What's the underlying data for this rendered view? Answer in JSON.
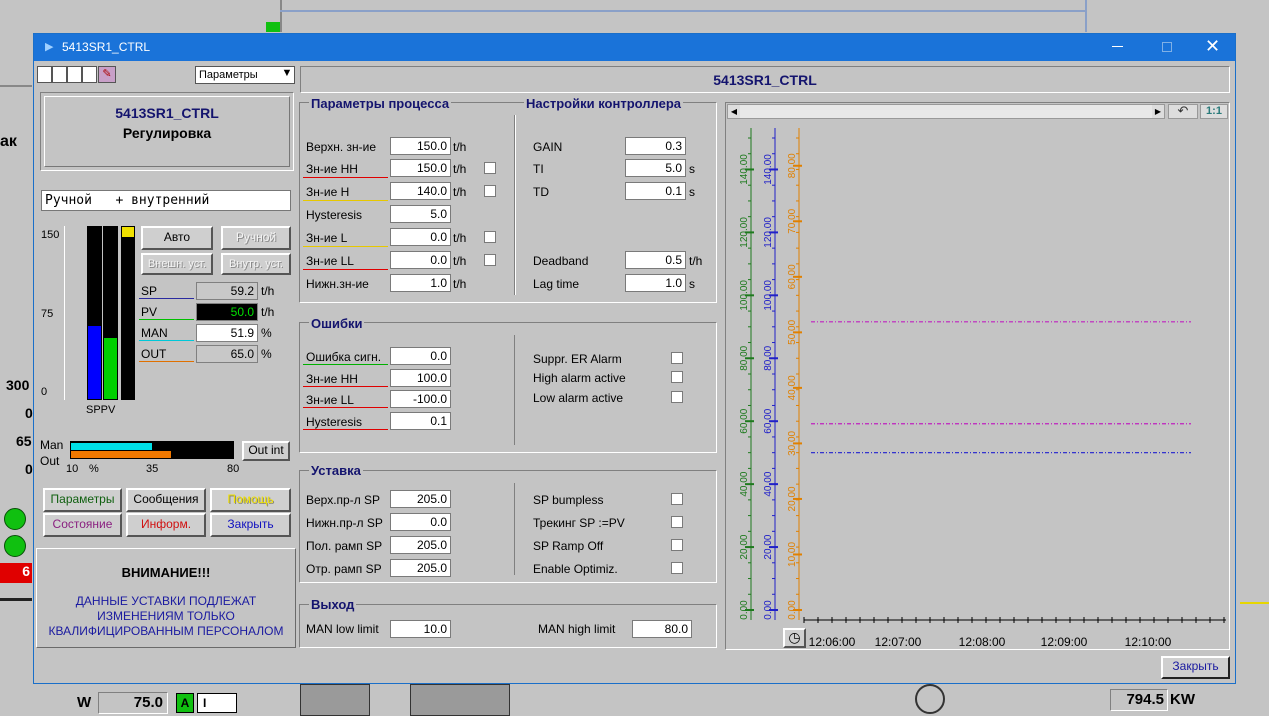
{
  "window": {
    "title": "5413SR1_CTRL"
  },
  "bg": {
    "v300": "300",
    "v0a": "0",
    "v65": "65",
    "v0b": "0",
    "v6": "6",
    "tak": "ак",
    "w_label": "W",
    "w_value": "75.0",
    "a_label": "A",
    "i_label": "I",
    "kw_value": "794.5",
    "kw_unit": "KW"
  },
  "left": {
    "dropdown_value": "Параметры",
    "faceplate_title": "5413SR1_CTRL",
    "faceplate_subtitle": "Регулировка",
    "mode_text": "Ручной   + внутренний",
    "scale": {
      "top": "150",
      "mid": "75",
      "bottom": "0"
    },
    "bars_label": "SPPV",
    "bars": {
      "sp": 0.423,
      "pv": 0.357,
      "out": 0.65,
      "indicator": "#f0e000"
    },
    "buttons": {
      "auto": "Авто",
      "manual": "Ручной",
      "ext_sp": "Внешн. уст.",
      "int_sp": "Внутр. уст."
    },
    "values": [
      {
        "label": "SP",
        "value": "59.2",
        "unit": "t/h",
        "color": "#2a2aa0"
      },
      {
        "label": "PV",
        "value": "50.0",
        "unit": "t/h",
        "color": "#00c000"
      },
      {
        "label": "MAN",
        "value": "51.9",
        "unit": "%",
        "color": "#00c8d8"
      },
      {
        "label": "OUT",
        "value": "65.0",
        "unit": "%",
        "color": "#e07000"
      }
    ],
    "man_label": "Man",
    "out_label": "Out",
    "man_level": 0.5,
    "out_level": 0.62,
    "out_int": "Out int",
    "scale_h": {
      "a": "10",
      "pct": "%",
      "b": "35",
      "c": "80"
    },
    "nav": {
      "params": "Параметры",
      "messages": "Сообщения",
      "help": "Помощь",
      "state": "Состояние",
      "info": "Информ.",
      "close": "Закрыть"
    },
    "warning_title": "ВНИМАНИЕ!!!",
    "warning_text": [
      "ДАННЫЕ УСТАВКИ ПОДЛЕЖАТ",
      "ИЗМЕНЕНИЯМ ТОЛЬКО",
      "КВАЛИФИЦИРОВАННЫМ ПЕРСОНАЛОМ"
    ]
  },
  "main": {
    "title": "5413SR1_CTRL",
    "process": {
      "header": "Параметры процесса",
      "rows": [
        {
          "label": "Верхн. зн-ие",
          "value": "150.0",
          "unit": "t/h"
        },
        {
          "label": "Зн-ие НН",
          "value": "150.0",
          "unit": "t/h"
        },
        {
          "label": "Зн-ие  Н",
          "value": "140.0",
          "unit": "t/h"
        },
        {
          "label": "Hysteresis",
          "value": "5.0",
          "unit": ""
        },
        {
          "label": "Зн-ие L",
          "value": "0.0",
          "unit": "t/h"
        },
        {
          "label": "Зн-ие LL",
          "value": "0.0",
          "unit": "t/h"
        },
        {
          "label": "Нижн.зн-ие",
          "value": "1.0",
          "unit": "t/h"
        }
      ]
    },
    "controller": {
      "header": "Настройки контроллера",
      "rows": [
        {
          "label": "GAIN",
          "value": "0.3",
          "unit": ""
        },
        {
          "label": "TI",
          "value": "5.0",
          "unit": "s"
        },
        {
          "label": "TD",
          "value": "0.1",
          "unit": "s"
        },
        {
          "label": "Deadband",
          "value": "0.5",
          "unit": "t/h"
        },
        {
          "label": "Lag time",
          "value": "1.0",
          "unit": "s"
        }
      ]
    },
    "errors": {
      "header": "Ошибки",
      "rows": [
        {
          "label": "Ошибка сигн.",
          "value": "0.0"
        },
        {
          "label": "Зн-ие НН",
          "value": "100.0"
        },
        {
          "label": "Зн-ие LL",
          "value": "-100.0"
        },
        {
          "label": "Hysteresis",
          "value": "0.1"
        }
      ],
      "flags": [
        "Suppr. ER Alarm",
        "High alarm active",
        "Low alarm active"
      ]
    },
    "setpoint": {
      "header": "Уставка",
      "rows": [
        {
          "label": "Верх.пр-л SP",
          "value": "205.0"
        },
        {
          "label": "Нижн.пр-л SP",
          "value": "0.0"
        },
        {
          "label": "Пол. рамп SP",
          "value": "205.0"
        },
        {
          "label": "Отр. рамп SP",
          "value": "205.0"
        }
      ],
      "flags": [
        "SP bumpless",
        "Трекинг SP :=PV",
        "SP Ramp Off",
        "Enable Optimiz."
      ]
    },
    "output": {
      "header": "Выход",
      "man_low_label": "MAN low limit",
      "man_low_value": "10.0",
      "man_high_label": "MAN high limit",
      "man_high_value": "80.0"
    },
    "close_button": "Закрыть"
  },
  "trend": {
    "zoom_label": "1:1",
    "axes": [
      {
        "color": "#1e7a1e",
        "ticks": [
          "0.00",
          "20.00",
          "40.00",
          "60.00",
          "80.00",
          "100.00",
          "120.00",
          "140.00"
        ],
        "min": 0,
        "max": 150
      },
      {
        "color": "#2020c8",
        "ticks": [
          "0.00",
          "20.00",
          "40.00",
          "60.00",
          "80.00",
          "100.00",
          "120.00",
          "140.00"
        ],
        "min": 0,
        "max": 150
      },
      {
        "color": "#e08000",
        "ticks": [
          "0.00",
          "10.00",
          "20.00",
          "30.00",
          "40.00",
          "50.00",
          "60.00",
          "70.00",
          "80.00"
        ],
        "min": 0,
        "max": 85
      }
    ],
    "times": [
      "12:06:00",
      "12:07:00",
      "12:08:00",
      "12:09:00",
      "12:10:00"
    ],
    "lines": [
      {
        "color": "#c020c0",
        "value": 59.2,
        "axis": 1
      },
      {
        "color": "#2020d0",
        "value": 50.0,
        "axis": 1
      },
      {
        "color": "#c020c0",
        "value": 51.9,
        "axis": 2
      }
    ]
  }
}
